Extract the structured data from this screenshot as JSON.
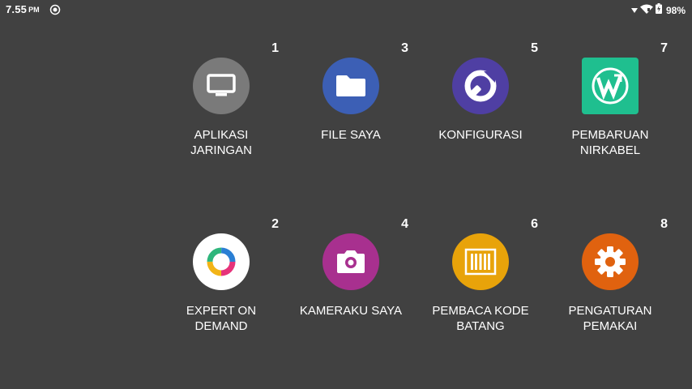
{
  "status_bar": {
    "time": "7.55",
    "ampm": "PM",
    "notification_icon": "sync-icon",
    "signal_icon": "signal-icon",
    "wifi_icon": "wifi-icon",
    "battery_icon": "battery-charging-icon",
    "battery_percent": "98%"
  },
  "apps": [
    {
      "number": "1",
      "label": "APLIKASI\nJARINGAN",
      "icon": "monitor-icon",
      "color": "#7a7a7a"
    },
    {
      "number": "3",
      "label": "FILE SAYA",
      "icon": "folder-icon",
      "color": "#3c5fb5"
    },
    {
      "number": "5",
      "label": "KONFIGURASI",
      "icon": "wrench-icon",
      "color": "#4f3fa3"
    },
    {
      "number": "7",
      "label": "PEMBARUAN\nNIRKABEL",
      "icon": "wireless-update-icon",
      "color": "#1fbf8f"
    },
    {
      "number": "2",
      "label": "EXPERT ON\nDEMAND",
      "icon": "expert-ring-icon",
      "color": "#ffffff"
    },
    {
      "number": "4",
      "label": "KAMERAKU SAYA",
      "icon": "camera-icon",
      "color": "#a8308f"
    },
    {
      "number": "6",
      "label": "PEMBACA KODE\nBATANG",
      "icon": "barcode-icon",
      "color": "#e8a30a"
    },
    {
      "number": "8",
      "label": "PENGATURAN\nPEMAKAI",
      "icon": "gear-icon",
      "color": "#e0620f"
    }
  ]
}
